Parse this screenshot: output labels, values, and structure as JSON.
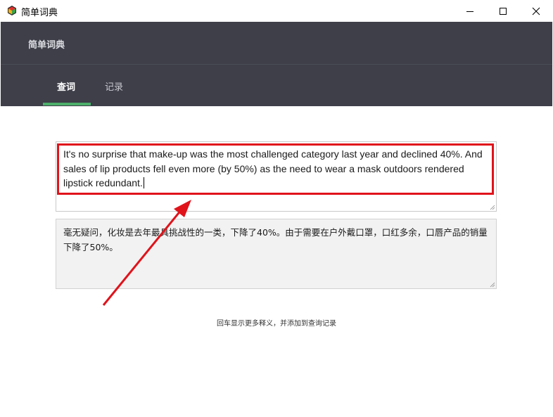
{
  "window": {
    "title": "简单词典"
  },
  "colors": {
    "header_bg": "#3e3f49",
    "tab_accent": "#4caf6a",
    "annotation": "#e0131b"
  },
  "header": {
    "brand": "简单词典",
    "tabs": [
      {
        "label": "查词",
        "active": true
      },
      {
        "label": "记录",
        "active": false
      }
    ]
  },
  "input": {
    "value": "It's no surprise that make-up was the most challenged category last year and declined 40%. And sales of lip products fell even more (by 50%) as the need to wear a mask outdoors rendered lipstick redundant."
  },
  "output": {
    "value": "毫无疑问，化妆是去年最具挑战性的一类，下降了40%。由于需要在户外戴口罩，口红多余，口唇产品的销量下降了50%。"
  },
  "hint": "回车显示更多释义，并添加到查询记录",
  "icons": {
    "app": "app-logo-icon",
    "minimize": "minimize-icon",
    "maximize": "maximize-icon",
    "close": "close-icon",
    "resize": "resize-grip-icon"
  }
}
